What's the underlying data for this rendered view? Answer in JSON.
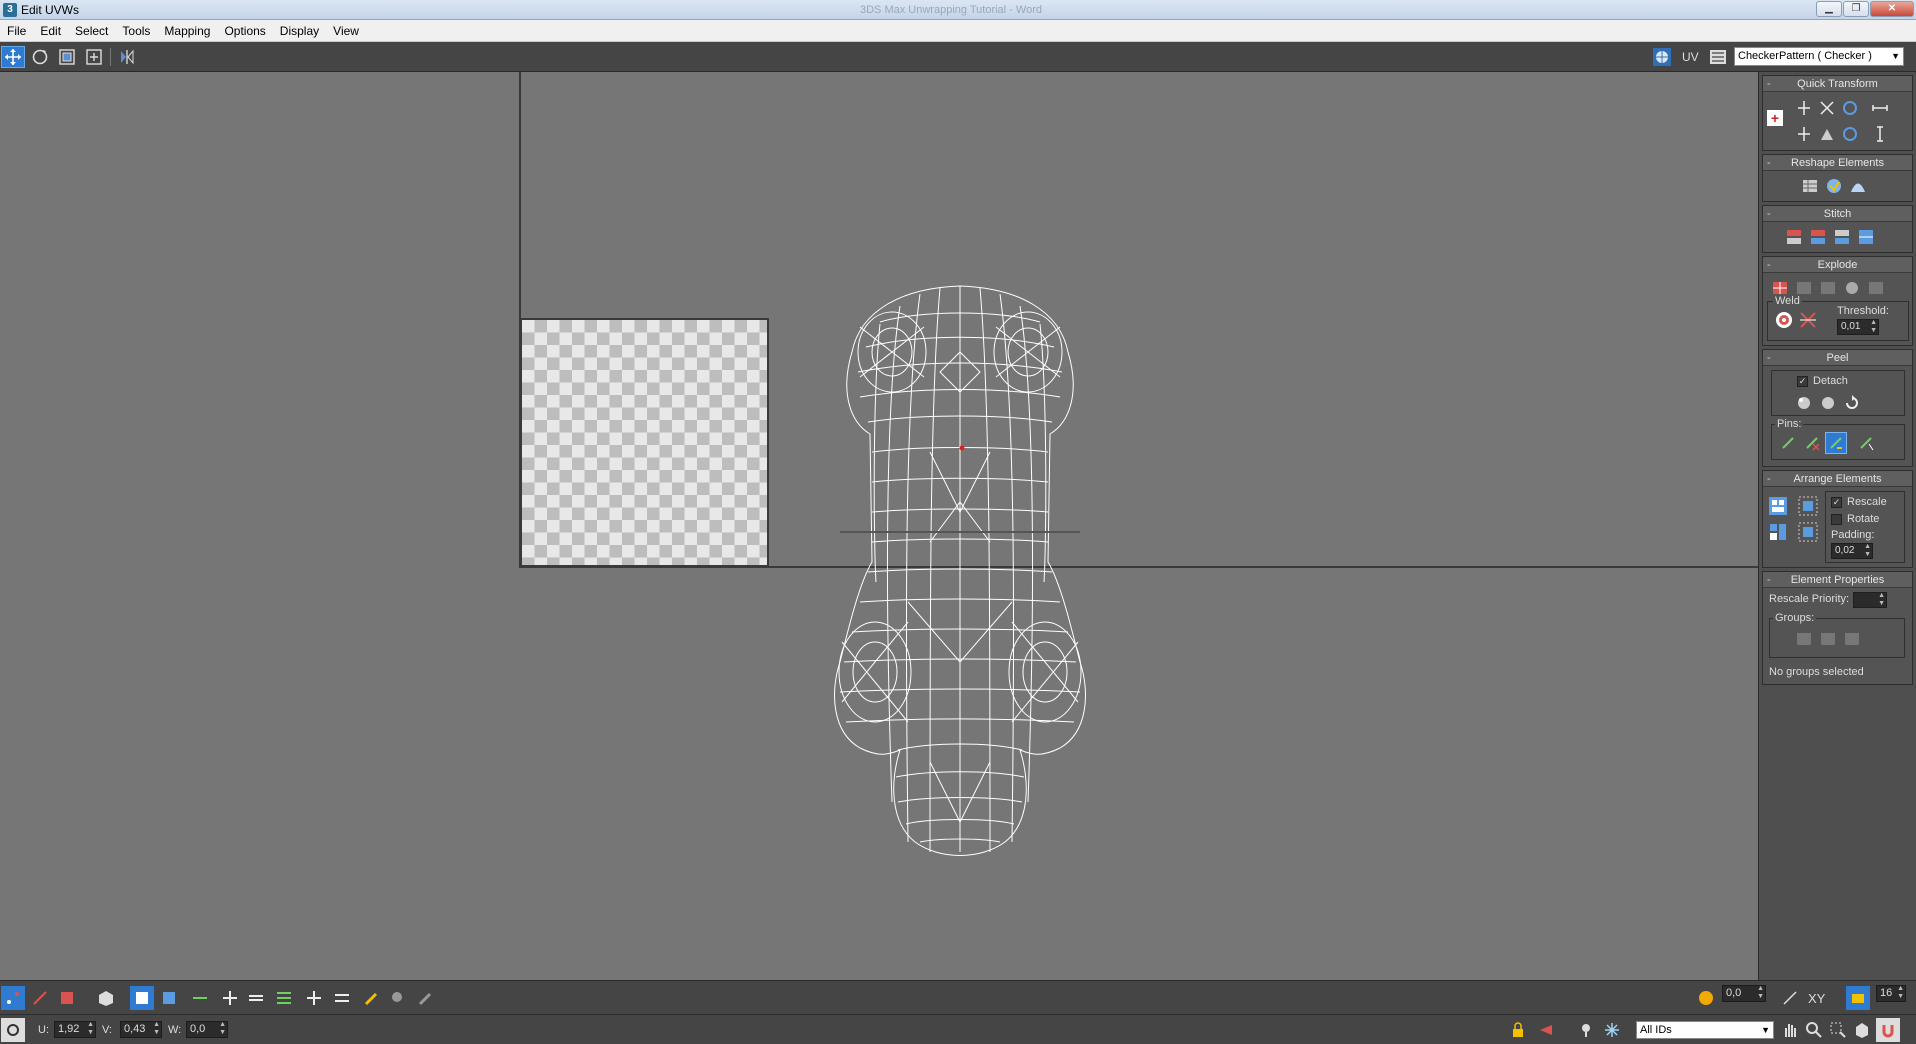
{
  "window": {
    "title": "Edit UVWs",
    "background_title": "3DS Max Unwrapping Tutorial - Word",
    "controls": [
      "minimize",
      "maximize",
      "close"
    ]
  },
  "menu": [
    "File",
    "Edit",
    "Select",
    "Tools",
    "Mapping",
    "Options",
    "Display",
    "View"
  ],
  "toolbar": {
    "left_tools": [
      "move-icon",
      "rotate-icon",
      "scale-icon",
      "freeform-icon",
      "mirror-icon"
    ],
    "uv_label": "UV",
    "texture_dropdown": "CheckerPattern  ( Checker )"
  },
  "panel": {
    "quick_transform": {
      "title": "Quick Transform"
    },
    "reshape_elements": {
      "title": "Reshape Elements"
    },
    "stitch": {
      "title": "Stitch"
    },
    "explode": {
      "title": "Explode",
      "weld_label": "Weld",
      "threshold_label": "Threshold:",
      "threshold_value": "0,01"
    },
    "peel": {
      "title": "Peel",
      "detach_label": "Detach",
      "detach_checked": true,
      "pins_label": "Pins:"
    },
    "arrange_elements": {
      "title": "Arrange Elements",
      "rescale_label": "Rescale",
      "rescale_checked": true,
      "rotate_label": "Rotate",
      "rotate_checked": false,
      "padding_label": "Padding:",
      "padding_value": "0,02"
    },
    "element_properties": {
      "title": "Element Properties",
      "rescale_priority_label": "Rescale Priority:",
      "rescale_priority_value": "",
      "groups_label": "Groups:",
      "status": "No groups selected"
    }
  },
  "bottom_toolbar": {
    "angle_value": "0,0",
    "axis_label": "XY",
    "grid_value": "16"
  },
  "statusbar": {
    "u_label": "U:",
    "u_value": "1,92",
    "v_label": "V:",
    "v_value": "0,43",
    "w_label": "W:",
    "w_value": "0,0",
    "ids_dropdown": "All IDs"
  },
  "colors": {
    "viewport_bg": "#767676",
    "ui_dark": "#454545",
    "panel_bg": "#4f4f4f",
    "accent_blue": "#2f7bd1",
    "mesh": "#ffffff"
  }
}
